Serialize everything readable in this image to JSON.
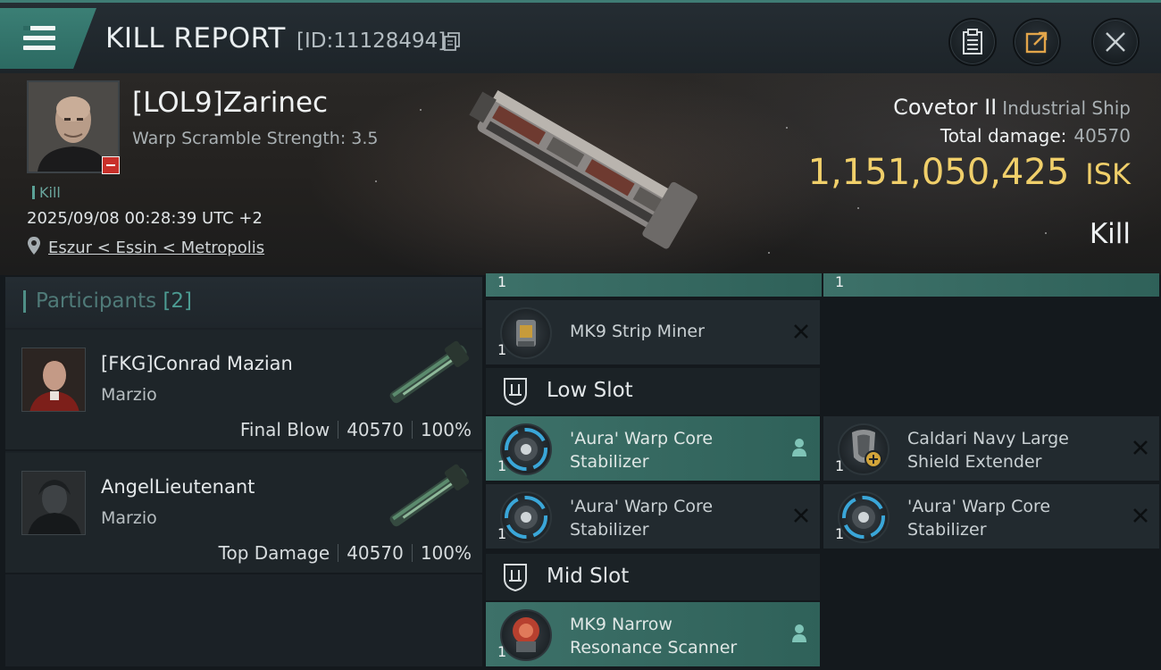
{
  "header": {
    "title": "KILL REPORT",
    "report_id": "[ID:11128494]"
  },
  "victim": {
    "name": "[LOL9]Zarinec",
    "warp_scramble": "Warp Scramble Strength: 3.5",
    "kill_tag": "Kill",
    "time": "2025/09/08 00:28:39 UTC +2",
    "location": "Eszur < Essin < Metropolis",
    "ship_name": "Covetor II",
    "ship_class": "Industrial Ship",
    "total_damage_label": "Total damage:",
    "total_damage": "40570",
    "isk_value": "1,151,050,425",
    "isk_unit": "ISK",
    "result": "Kill"
  },
  "participants": {
    "label": "Participants",
    "count": "[2]",
    "rows": [
      {
        "name": "[FKG]Conrad Mazian",
        "ship": "Marzio",
        "role": "Final Blow",
        "damage": "40570",
        "percent": "100%"
      },
      {
        "name": "AngelLieutenant",
        "ship": "Marzio",
        "role": "Top Damage",
        "damage": "40570",
        "percent": "100%"
      }
    ]
  },
  "fitting": {
    "top_left_qty": "1",
    "top_right_qty": "1",
    "high_slot_item": {
      "qty": "1",
      "name": "MK9 Strip Miner"
    },
    "low_slot_title": "Low Slot",
    "low_slot_items": [
      {
        "qty": "1",
        "name_line1": "'Aura' Warp Core",
        "name_line2": "Stabilizer",
        "state": "active"
      },
      {
        "qty": "1",
        "name_line1": "Caldari Navy Large",
        "name_line2": "Shield Extender",
        "state": "destroyed"
      },
      {
        "qty": "1",
        "name_line1": "'Aura' Warp Core",
        "name_line2": "Stabilizer",
        "state": "destroyed"
      },
      {
        "qty": "1",
        "name_line1": "'Aura' Warp Core",
        "name_line2": "Stabilizer",
        "state": "destroyed"
      }
    ],
    "mid_slot_title": "Mid Slot",
    "mid_slot_items": [
      {
        "qty": "1",
        "name_line1": "MK9 Narrow",
        "name_line2": "Resonance Scanner",
        "state": "active"
      }
    ]
  },
  "colors": {
    "accent_teal": "#3d7169",
    "isk_gold": "#f0cf6a",
    "panel_bg": "#1e2529",
    "kill_badge_red": "#c8302a"
  },
  "icons": [
    "menu-icon",
    "copy-icon",
    "clipboard-icon",
    "share-icon",
    "close-icon",
    "pin-icon",
    "shield-slot-icon",
    "x-icon",
    "person-icon"
  ]
}
